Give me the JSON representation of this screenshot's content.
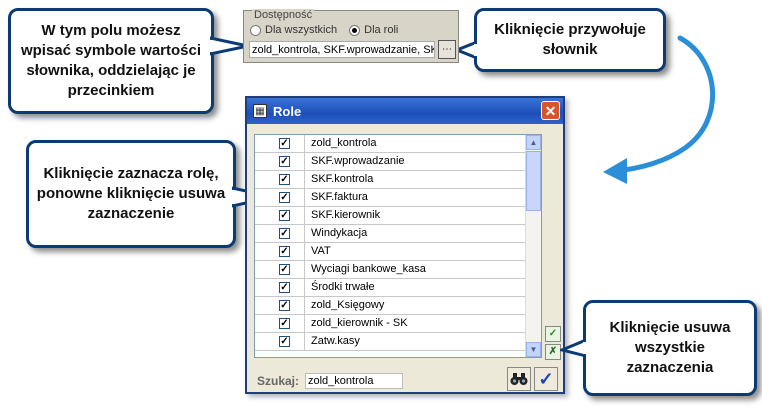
{
  "callouts": {
    "field_hint": "W tym polu możesz wpisać symbole wartości słownika, oddzielając je przecinkiem",
    "dict_hint": "Kliknięcie przywołuje słownik",
    "toggle_hint": "Kliknięcie zaznacza rolę, ponowne kliknięcie usuwa zaznaczenie",
    "clear_hint": "Kliknięcie usuwa wszystkie zaznaczenia"
  },
  "availability": {
    "legend": "Dostępność",
    "option_all": "Dla wszystkich",
    "option_role": "Dla roli",
    "selected": "Dla roli",
    "value": "zold_kontrola, SKF.wprowadzanie, SKF"
  },
  "window": {
    "title": "Role",
    "close_glyph": "✕"
  },
  "roles": [
    {
      "label": "zold_kontrola",
      "checked": true
    },
    {
      "label": "SKF.wprowadzanie",
      "checked": true
    },
    {
      "label": "SKF.kontrola",
      "checked": true
    },
    {
      "label": "SKF.faktura",
      "checked": true
    },
    {
      "label": "SKF.kierownik",
      "checked": true
    },
    {
      "label": "Windykacja",
      "checked": true
    },
    {
      "label": "VAT",
      "checked": true
    },
    {
      "label": "Wyciagi bankowe_kasa",
      "checked": true
    },
    {
      "label": "Środki trwałe",
      "checked": true
    },
    {
      "label": "zold_Księgowy",
      "checked": true
    },
    {
      "label": "zold_kierownik - SK",
      "checked": true
    },
    {
      "label": "Zatw.kasy",
      "checked": true
    }
  ],
  "search": {
    "label": "Szukaj:",
    "value": "zold_kontrola"
  },
  "colors": {
    "callout_border": "#0b3b73",
    "arrow": "#2a8fd8",
    "titlebar": "#2456c4"
  }
}
